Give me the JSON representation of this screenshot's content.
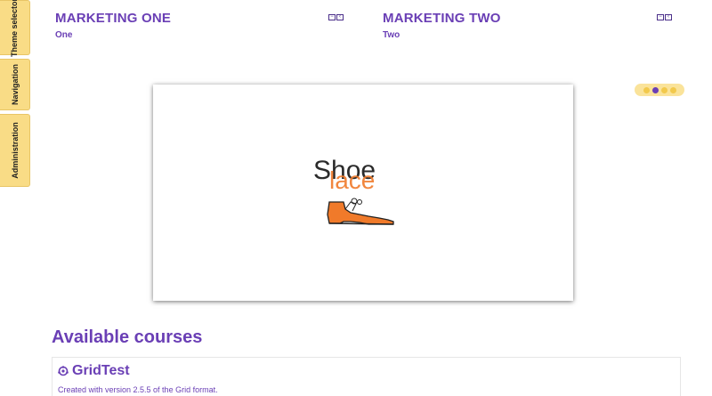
{
  "dock": {
    "tabs": [
      {
        "label": "Theme selector"
      },
      {
        "label": "Navigation"
      },
      {
        "label": "Administration"
      }
    ]
  },
  "marketing": [
    {
      "title": "MARKETING ONE",
      "subtitle": "One"
    },
    {
      "title": "MARKETING TWO",
      "subtitle": "Two"
    }
  ],
  "slider": {
    "text_main": "Shoe",
    "text_overlay": "lace",
    "image": "orange-shoe",
    "dots_total": 4,
    "active_dot": 2
  },
  "courses": {
    "heading": "Available courses",
    "items": [
      {
        "name": "GridTest",
        "description": "Created with version 2.5.5 of the Grid format.",
        "icon": "course-icon"
      }
    ]
  },
  "colors": {
    "accent": "#6a3fb5",
    "dock": "#f9dc86",
    "shoe": "#f07a2a"
  }
}
